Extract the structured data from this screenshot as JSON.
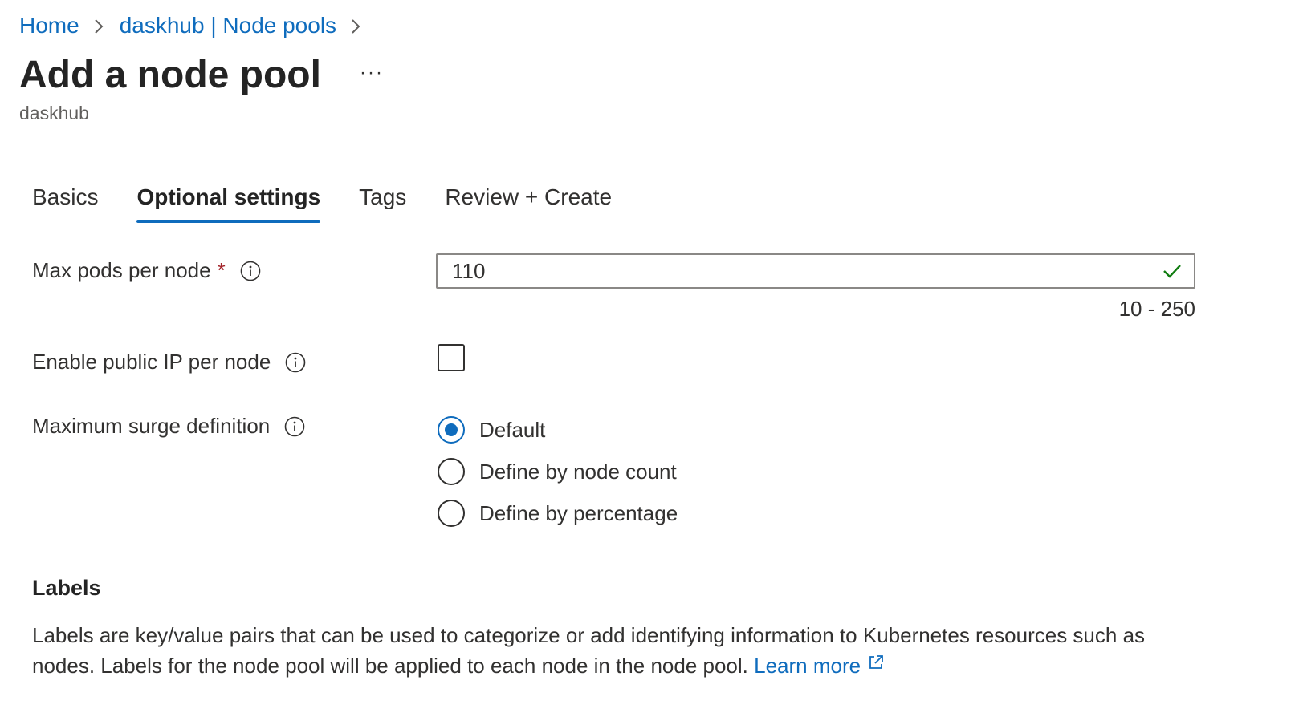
{
  "breadcrumb": {
    "items": [
      "Home",
      "daskhub | Node pools"
    ]
  },
  "header": {
    "title": "Add a node pool",
    "more_label": "···",
    "subtitle": "daskhub"
  },
  "tabs": [
    {
      "label": "Basics",
      "active": false
    },
    {
      "label": "Optional settings",
      "active": true
    },
    {
      "label": "Tags",
      "active": false
    },
    {
      "label": "Review + Create",
      "active": false
    }
  ],
  "form": {
    "max_pods": {
      "label": "Max pods per node",
      "required_mark": "*",
      "value": "110",
      "range_hint": "10 - 250",
      "valid": true
    },
    "public_ip": {
      "label": "Enable public IP per node",
      "checked": false
    },
    "max_surge": {
      "label": "Maximum surge definition",
      "options": [
        {
          "label": "Default",
          "selected": true
        },
        {
          "label": "Define by node count",
          "selected": false
        },
        {
          "label": "Define by percentage",
          "selected": false
        }
      ]
    }
  },
  "labels_section": {
    "heading": "Labels",
    "description": "Labels are key/value pairs that can be used to categorize or add identifying information to Kubernetes resources such as nodes. Labels for the node pool will be applied to each node in the node pool.",
    "learn_more": "Learn more"
  },
  "colors": {
    "accent": "#0f6cbd",
    "required": "#a4262c",
    "valid": "#107c10"
  }
}
